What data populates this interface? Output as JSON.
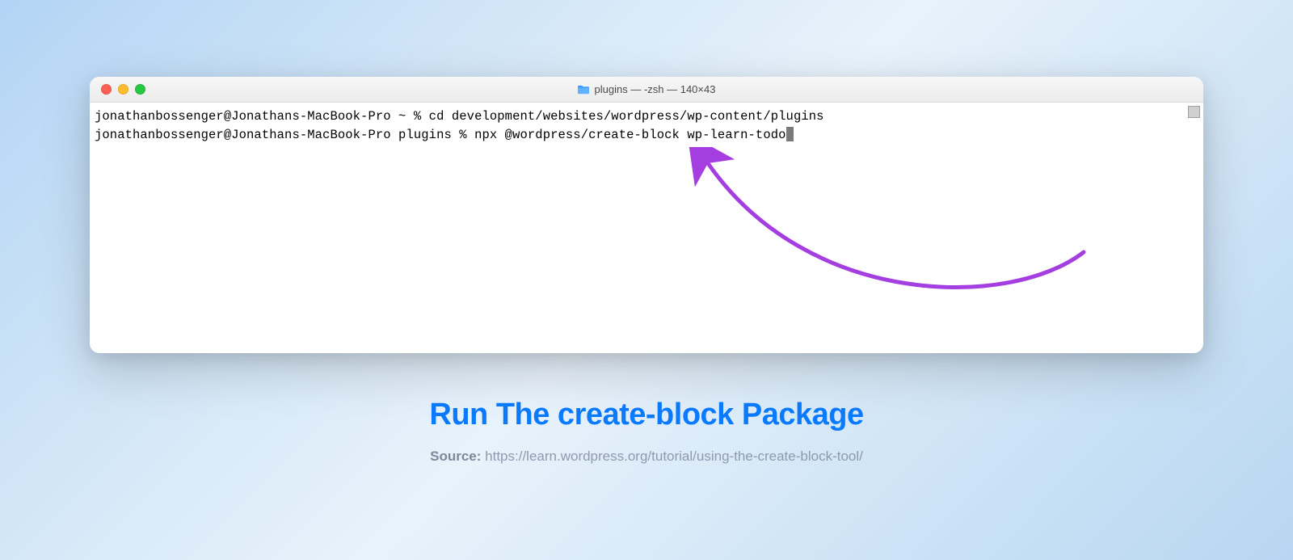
{
  "window": {
    "title": "plugins — -zsh — 140×43"
  },
  "terminal": {
    "line1_prompt": "jonathanbossenger@Jonathans-MacBook-Pro ~ % ",
    "line1_cmd": "cd development/websites/wordpress/wp-content/plugins",
    "line2_prompt": "jonathanbossenger@Jonathans-MacBook-Pro plugins % ",
    "line2_cmd": "npx @wordpress/create-block wp-learn-todo"
  },
  "caption": {
    "title": "Run The create-block Package",
    "source_label": "Source: ",
    "source_url": "https://learn.wordpress.org/tutorial/using-the-create-block-tool/"
  },
  "colors": {
    "accent_blue": "#0a7bff",
    "arrow_purple": "#a43ee0"
  }
}
